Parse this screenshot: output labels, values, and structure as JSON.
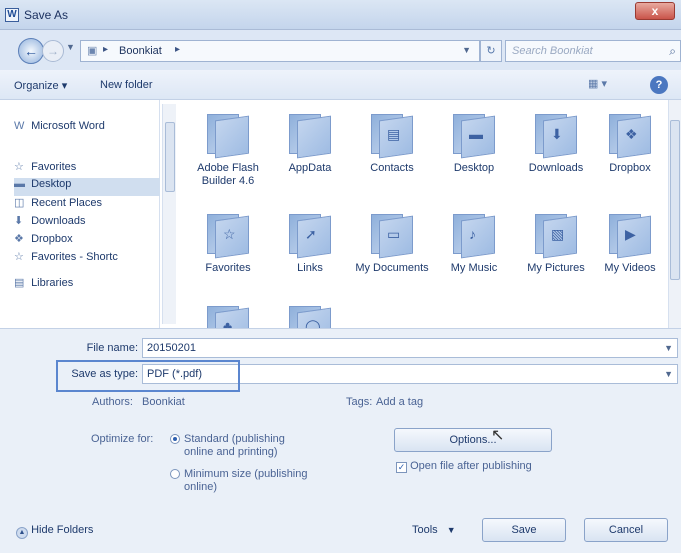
{
  "window": {
    "title": "Save As",
    "app_icon": "W",
    "close_label": "x"
  },
  "nav": {
    "path_root": "Boonkiat",
    "search_placeholder": "Search Boonkiat"
  },
  "toolbar": {
    "organize": "Organize ▾",
    "new_folder": "New folder",
    "help": "?"
  },
  "sidebar": {
    "items": [
      {
        "label": "Microsoft Word",
        "icon": "word-icon"
      },
      {
        "label": "Favorites",
        "icon": "star-icon"
      },
      {
        "label": "Desktop",
        "icon": "desktop-icon",
        "selected": true
      },
      {
        "label": "Recent Places",
        "icon": "recent-places-icon"
      },
      {
        "label": "Downloads",
        "icon": "downloads-icon"
      },
      {
        "label": "Dropbox",
        "icon": "dropbox-icon"
      },
      {
        "label": "Favorites - Shortc",
        "icon": "star-icon"
      },
      {
        "label": "Libraries",
        "icon": "libraries-icon"
      }
    ]
  },
  "files": [
    {
      "label": "Adobe Flash Builder 4.6"
    },
    {
      "label": "AppData"
    },
    {
      "label": "Contacts"
    },
    {
      "label": "Desktop"
    },
    {
      "label": "Downloads"
    },
    {
      "label": "Dropbox"
    },
    {
      "label": "Favorites"
    },
    {
      "label": "Links"
    },
    {
      "label": "My Documents"
    },
    {
      "label": "My Music"
    },
    {
      "label": "My Pictures"
    },
    {
      "label": "My Videos"
    },
    {
      "label": ""
    },
    {
      "label": ""
    }
  ],
  "form": {
    "file_name_label": "File name:",
    "file_name_value": "20150201",
    "save_type_label": "Save as type:",
    "save_type_value": "PDF (*.pdf)",
    "authors_label": "Authors:",
    "authors_value": "Boonkiat",
    "tags_label": "Tags:",
    "tags_value": "Add a tag",
    "optimize_label": "Optimize for:",
    "optimize_standard": "Standard (publishing online and printing)",
    "optimize_minimum": "Minimum size (publishing online)",
    "options_button": "Options...",
    "open_after_label": "Open file after publishing",
    "open_after_checked": true
  },
  "footer": {
    "hide_folders": "Hide Folders",
    "tools": "Tools",
    "save": "Save",
    "cancel": "Cancel"
  }
}
